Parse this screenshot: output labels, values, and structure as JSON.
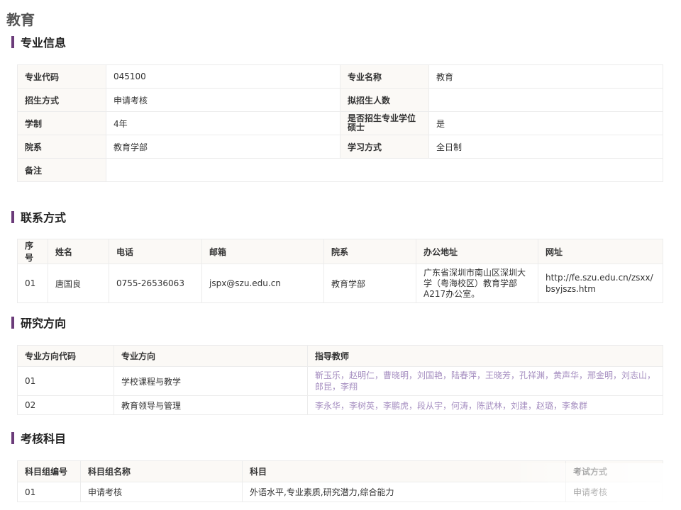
{
  "page_title": "教育",
  "major_info": {
    "title": "专业信息",
    "rows": [
      {
        "l1": "专业代码",
        "v1": "045100",
        "l2": "专业名称",
        "v2": "教育"
      },
      {
        "l1": "招生方式",
        "v1": "申请考核",
        "l2": "拟招生人数",
        "v2": ""
      },
      {
        "l1": "学制",
        "v1": "4年",
        "l2": "是否招生专业学位硕士",
        "v2": "是"
      },
      {
        "l1": "院系",
        "v1": "教育学部",
        "l2": "学习方式",
        "v2": "全日制"
      }
    ],
    "remark_label": "备注",
    "remark_value": ""
  },
  "contact": {
    "title": "联系方式",
    "headers": [
      "序号",
      "姓名",
      "电话",
      "邮箱",
      "院系",
      "办公地址",
      "网址"
    ],
    "row": [
      "01",
      "唐国良",
      "0755-26536063",
      "jspx@szu.edu.cn",
      "教育学部",
      "广东省深圳市南山区深圳大学（粤海校区）教育学部A217办公室。",
      "http://fe.szu.edu.cn/zsxx/bsyjszs.htm"
    ]
  },
  "research": {
    "title": "研究方向",
    "headers": [
      "专业方向代码",
      "专业方向",
      "指导教师"
    ],
    "rows": [
      {
        "code": "01",
        "name": "学校课程与教学",
        "teachers": "靳玉乐，赵明仁，曹晓明，刘国艳，陆春萍，王晓芳，孔祥渊，黄声华，邢金明，刘志山，郎昆，李翔"
      },
      {
        "code": "02",
        "name": "教育领导与管理",
        "teachers": "李永华，李树英，李鹏虎，段从宇，何涛，陈武林，刘建，赵璐，李象群"
      }
    ]
  },
  "exam": {
    "title": "考核科目",
    "headers": [
      "科目组编号",
      "科目组名称",
      "科目",
      "考试方式"
    ],
    "row": [
      "01",
      "申请考核",
      "外语水平,专业素质,研究潜力,综合能力",
      "申请考核"
    ]
  }
}
